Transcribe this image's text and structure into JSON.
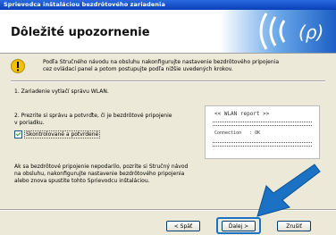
{
  "window": {
    "title": "Sprievodca inštaláciou bezdrôtového zariadenia"
  },
  "header": {
    "title": "Dôležité upozornenie"
  },
  "notice": {
    "line1": "Podľa Stručného návodu na obsluhu nakonfigurujte nastavenie bezdrôtového pripojenia",
    "line2": "cez ovládací panel a potom postupujte podľa nižšie uvedených krokov."
  },
  "steps": {
    "step1": "1. Zariadenie vytlačí správu WLAN.",
    "step2_line1": "2. Prezrite si správu a potvrďte, či je bezdrôtové pripojenie",
    "step2_line2": "v poriadku."
  },
  "checkbox": {
    "label": "Skontrolované a potvrdené",
    "checked": true
  },
  "report": {
    "title": "<< WLAN report >>",
    "connection_label": "Connection",
    "connection_value": ": OK"
  },
  "paragraph": {
    "line1": "Ak sa bezdrôtové pripojenie nepodarilo, pozrite si Stručný návod",
    "line2": "na obsluhu, nakonfigurujte nastavenie bezdrôtového pripojenia",
    "line3": "alebo znova spustite tohto Sprievodcu inštaláciou."
  },
  "buttons": {
    "back": "< Späť",
    "next": "Ďalej >",
    "cancel": "Zrušiť"
  },
  "colors": {
    "titlebar": "#0a3fb8",
    "accent_arrow": "#1b72c4"
  }
}
